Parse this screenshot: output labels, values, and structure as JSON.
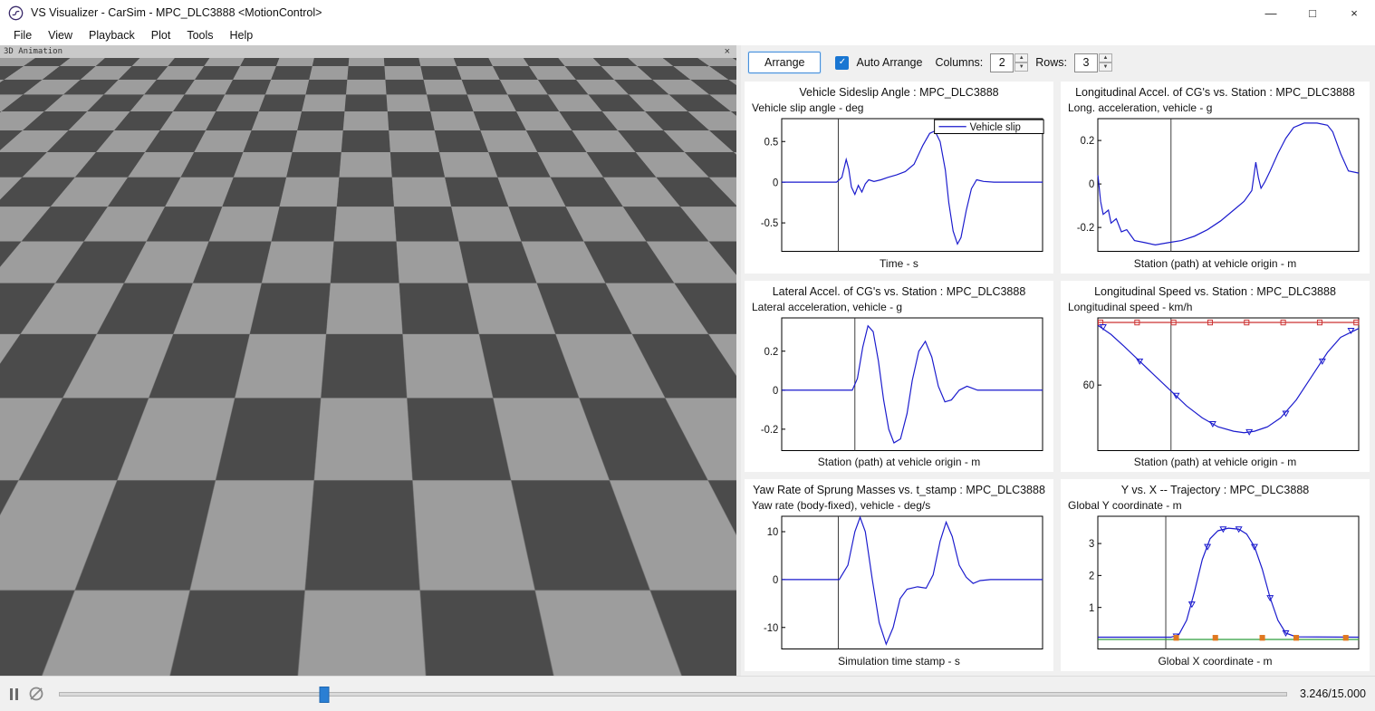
{
  "window": {
    "title": "VS Visualizer - CarSim - MPC_DLC3888 <MotionControl>",
    "controls": {
      "minimize": "—",
      "maximize": "□",
      "close": "×"
    }
  },
  "menu": {
    "items": [
      "File",
      "View",
      "Playback",
      "Plot",
      "Tools",
      "Help"
    ]
  },
  "animation": {
    "title": "3D Animation",
    "close": "×"
  },
  "plot_toolbar": {
    "arrange": "Arrange",
    "auto_arrange_label": "Auto Arrange",
    "auto_arrange_checked": true,
    "check_glyph": "✓",
    "columns_label": "Columns:",
    "columns_value": "2",
    "rows_label": "Rows:",
    "rows_value": "3",
    "spin_up": "▲",
    "spin_down": "▼"
  },
  "playback": {
    "time_display": "3.246/15.000",
    "current_time": 3.246,
    "total_time": 15.0,
    "fraction": 0.2164
  },
  "chart_data": [
    {
      "type": "line",
      "title": "Vehicle Sideslip Angle : MPC_DLC3888",
      "ylabel": "Vehicle slip angle - deg",
      "xlabel": "Time - s",
      "xlim": [
        0,
        15
      ],
      "ylim": [
        -0.85,
        0.78
      ],
      "yticks": [
        0.5,
        0,
        -0.5
      ],
      "cursor_x": 3.246,
      "legend": {
        "label": "Vehicle slip",
        "color": "#1a1acd"
      },
      "series": [
        {
          "name": "Vehicle slip angle",
          "type": "line",
          "color": "#1a1acd",
          "x": [
            0,
            3.15,
            3.45,
            3.7,
            3.85,
            4.0,
            4.2,
            4.4,
            4.6,
            4.8,
            5.0,
            5.3,
            5.7,
            6.1,
            6.6,
            7.1,
            7.6,
            8.1,
            8.5,
            8.8,
            9.1,
            9.4,
            9.6,
            9.85,
            10.1,
            10.3,
            10.6,
            10.9,
            11.2,
            11.6,
            12.2,
            15
          ],
          "y": [
            0,
            0,
            0.06,
            0.28,
            0.16,
            -0.06,
            -0.15,
            -0.04,
            -0.12,
            -0.02,
            0.03,
            0.01,
            0.03,
            0.06,
            0.09,
            0.13,
            0.22,
            0.45,
            0.6,
            0.63,
            0.5,
            0.15,
            -0.25,
            -0.6,
            -0.76,
            -0.68,
            -0.35,
            -0.08,
            0.03,
            0.01,
            0,
            0
          ]
        }
      ]
    },
    {
      "type": "line",
      "title": "Longitudinal Accel. of CG's vs. Station : MPC_DLC3888",
      "ylabel": "Long. acceleration, vehicle - g",
      "xlabel": "Station (path) at vehicle origin - m",
      "xlim": [
        0,
        1
      ],
      "ylim": [
        -0.31,
        0.3
      ],
      "yticks": [
        0.2,
        0,
        -0.2
      ],
      "cursor_x": 0.28,
      "series": [
        {
          "name": "Long. acceleration",
          "type": "line",
          "color": "#1a1acd",
          "x": [
            0,
            0.01,
            0.02,
            0.04,
            0.05,
            0.07,
            0.09,
            0.11,
            0.14,
            0.18,
            0.22,
            0.27,
            0.32,
            0.37,
            0.42,
            0.47,
            0.52,
            0.56,
            0.59,
            0.605,
            0.615,
            0.625,
            0.64,
            0.66,
            0.69,
            0.72,
            0.75,
            0.79,
            0.84,
            0.88,
            0.9,
            0.93,
            0.96,
            1.0
          ],
          "y": [
            0.04,
            -0.08,
            -0.14,
            -0.12,
            -0.18,
            -0.16,
            -0.22,
            -0.21,
            -0.26,
            -0.27,
            -0.28,
            -0.27,
            -0.26,
            -0.24,
            -0.21,
            -0.17,
            -0.12,
            -0.08,
            -0.03,
            0.1,
            0.03,
            -0.02,
            0.01,
            0.06,
            0.14,
            0.21,
            0.26,
            0.28,
            0.28,
            0.27,
            0.24,
            0.14,
            0.06,
            0.05
          ]
        }
      ]
    },
    {
      "type": "line",
      "title": "Lateral Accel. of CG's vs. Station : MPC_DLC3888",
      "ylabel": "Lateral acceleration, vehicle - g",
      "xlabel": "Station (path) at vehicle origin - m",
      "xlim": [
        0,
        1
      ],
      "ylim": [
        -0.31,
        0.37
      ],
      "yticks": [
        0.2,
        0,
        -0.2
      ],
      "cursor_x": 0.28,
      "series": [
        {
          "name": "Lateral acceleration",
          "type": "line",
          "color": "#1a1acd",
          "x": [
            0,
            0.27,
            0.29,
            0.31,
            0.33,
            0.35,
            0.37,
            0.39,
            0.41,
            0.43,
            0.455,
            0.48,
            0.5,
            0.525,
            0.55,
            0.575,
            0.6,
            0.625,
            0.65,
            0.68,
            0.71,
            0.75,
            0.8,
            1.0
          ],
          "y": [
            0,
            0,
            0.06,
            0.22,
            0.33,
            0.3,
            0.15,
            -0.05,
            -0.2,
            -0.27,
            -0.25,
            -0.12,
            0.05,
            0.2,
            0.25,
            0.17,
            0.02,
            -0.06,
            -0.05,
            0,
            0.02,
            0,
            0,
            0
          ]
        }
      ]
    },
    {
      "type": "line",
      "title": "Longitudinal Speed vs. Station : MPC_DLC3888",
      "ylabel": "Longitudinal speed - km/h",
      "xlabel": "Station (path) at vehicle origin - m",
      "xlim": [
        0,
        1
      ],
      "ylim": [
        38,
        82.5
      ],
      "yticks": [
        60
      ],
      "cursor_x": 0.28,
      "series": [
        {
          "name": "Target speed",
          "type": "line",
          "color": "#cc3333",
          "x": [
            0,
            1
          ],
          "y": [
            81,
            81
          ]
        },
        {
          "name": "Target speed markers",
          "type": "scatter",
          "marker": "square",
          "color": "#cc3333",
          "x": [
            0.01,
            0.15,
            0.29,
            0.43,
            0.57,
            0.71,
            0.85,
            0.99
          ],
          "y": [
            81,
            81,
            81,
            81,
            81,
            81,
            81,
            81
          ]
        },
        {
          "name": "Longitudinal speed",
          "type": "line",
          "color": "#1a1acd",
          "x": [
            0,
            0.05,
            0.1,
            0.16,
            0.22,
            0.28,
            0.34,
            0.4,
            0.46,
            0.52,
            0.56,
            0.6,
            0.65,
            0.7,
            0.76,
            0.82,
            0.88,
            0.93,
            1.0
          ],
          "y": [
            80,
            77,
            73,
            68,
            63,
            58,
            53,
            49,
            46,
            44.5,
            44,
            44.5,
            46,
            49,
            55,
            63,
            71,
            76,
            79
          ]
        },
        {
          "name": "Speed markers",
          "type": "scatter",
          "marker": "triangle-down",
          "color": "#1a1acd",
          "x": [
            0.02,
            0.16,
            0.3,
            0.44,
            0.58,
            0.72,
            0.86,
            0.97
          ],
          "y": [
            79.5,
            68,
            56.5,
            47,
            44.3,
            50.5,
            68,
            78.3
          ]
        }
      ]
    },
    {
      "type": "line",
      "title": "Yaw Rate of Sprung Masses vs. t_stamp : MPC_DLC3888",
      "ylabel": "Yaw rate (body-fixed), vehicle - deg/s",
      "xlabel": "Simulation time stamp - s",
      "xlim": [
        0,
        15
      ],
      "ylim": [
        -14.5,
        13.2
      ],
      "yticks": [
        10,
        0,
        -10
      ],
      "cursor_x": 3.246,
      "series": [
        {
          "name": "Yaw rate",
          "type": "line",
          "color": "#1a1acd",
          "x": [
            0,
            3.3,
            3.8,
            4.2,
            4.5,
            4.8,
            5.2,
            5.6,
            6.0,
            6.4,
            6.8,
            7.2,
            7.8,
            8.3,
            8.7,
            9.1,
            9.45,
            9.8,
            10.2,
            10.6,
            11.0,
            11.4,
            12.0,
            15
          ],
          "y": [
            0,
            0,
            3,
            10,
            13,
            10,
            0,
            -9,
            -13.5,
            -10,
            -4,
            -2,
            -1.5,
            -1.8,
            1,
            8,
            12,
            9,
            3,
            0.5,
            -0.8,
            -0.2,
            0,
            0
          ]
        }
      ]
    },
    {
      "type": "line",
      "title": "Y vs. X -- Trajectory : MPC_DLC3888",
      "ylabel": "Global Y coordinate - m",
      "xlabel": "Global X coordinate - m",
      "xlim": [
        0,
        1
      ],
      "ylim": [
        -0.3,
        3.85
      ],
      "yticks": [
        3,
        2,
        1
      ],
      "cursor_x": 0.26,
      "series": [
        {
          "name": "Reference path",
          "type": "line",
          "color": "#2e9e3e",
          "x": [
            0,
            1
          ],
          "y": [
            0,
            0
          ]
        },
        {
          "name": "Vehicle trajectory",
          "type": "line",
          "color": "#1a1acd",
          "x": [
            0,
            0.28,
            0.31,
            0.34,
            0.37,
            0.4,
            0.43,
            0.46,
            0.5,
            0.54,
            0.57,
            0.6,
            0.63,
            0.66,
            0.69,
            0.72,
            0.76,
            1.0
          ],
          "y": [
            0.07,
            0.07,
            0.15,
            0.6,
            1.5,
            2.5,
            3.15,
            3.4,
            3.48,
            3.45,
            3.3,
            2.9,
            2.2,
            1.3,
            0.6,
            0.2,
            0.08,
            0.07
          ]
        },
        {
          "name": "Trajectory markers",
          "type": "scatter",
          "marker": "triangle-down",
          "color": "#1a1acd",
          "x": [
            0.3,
            0.36,
            0.42,
            0.48,
            0.54,
            0.6,
            0.66,
            0.72
          ],
          "y": [
            0.1,
            1.1,
            2.9,
            3.45,
            3.45,
            2.9,
            1.3,
            0.2
          ]
        },
        {
          "name": "Cone markers",
          "type": "scatter",
          "marker": "square",
          "color": "#e07820",
          "fill": "#e07820",
          "x": [
            0.3,
            0.45,
            0.63,
            0.76,
            0.95
          ],
          "y": [
            0.05,
            0.05,
            0.05,
            0.05,
            0.05
          ]
        }
      ]
    }
  ]
}
